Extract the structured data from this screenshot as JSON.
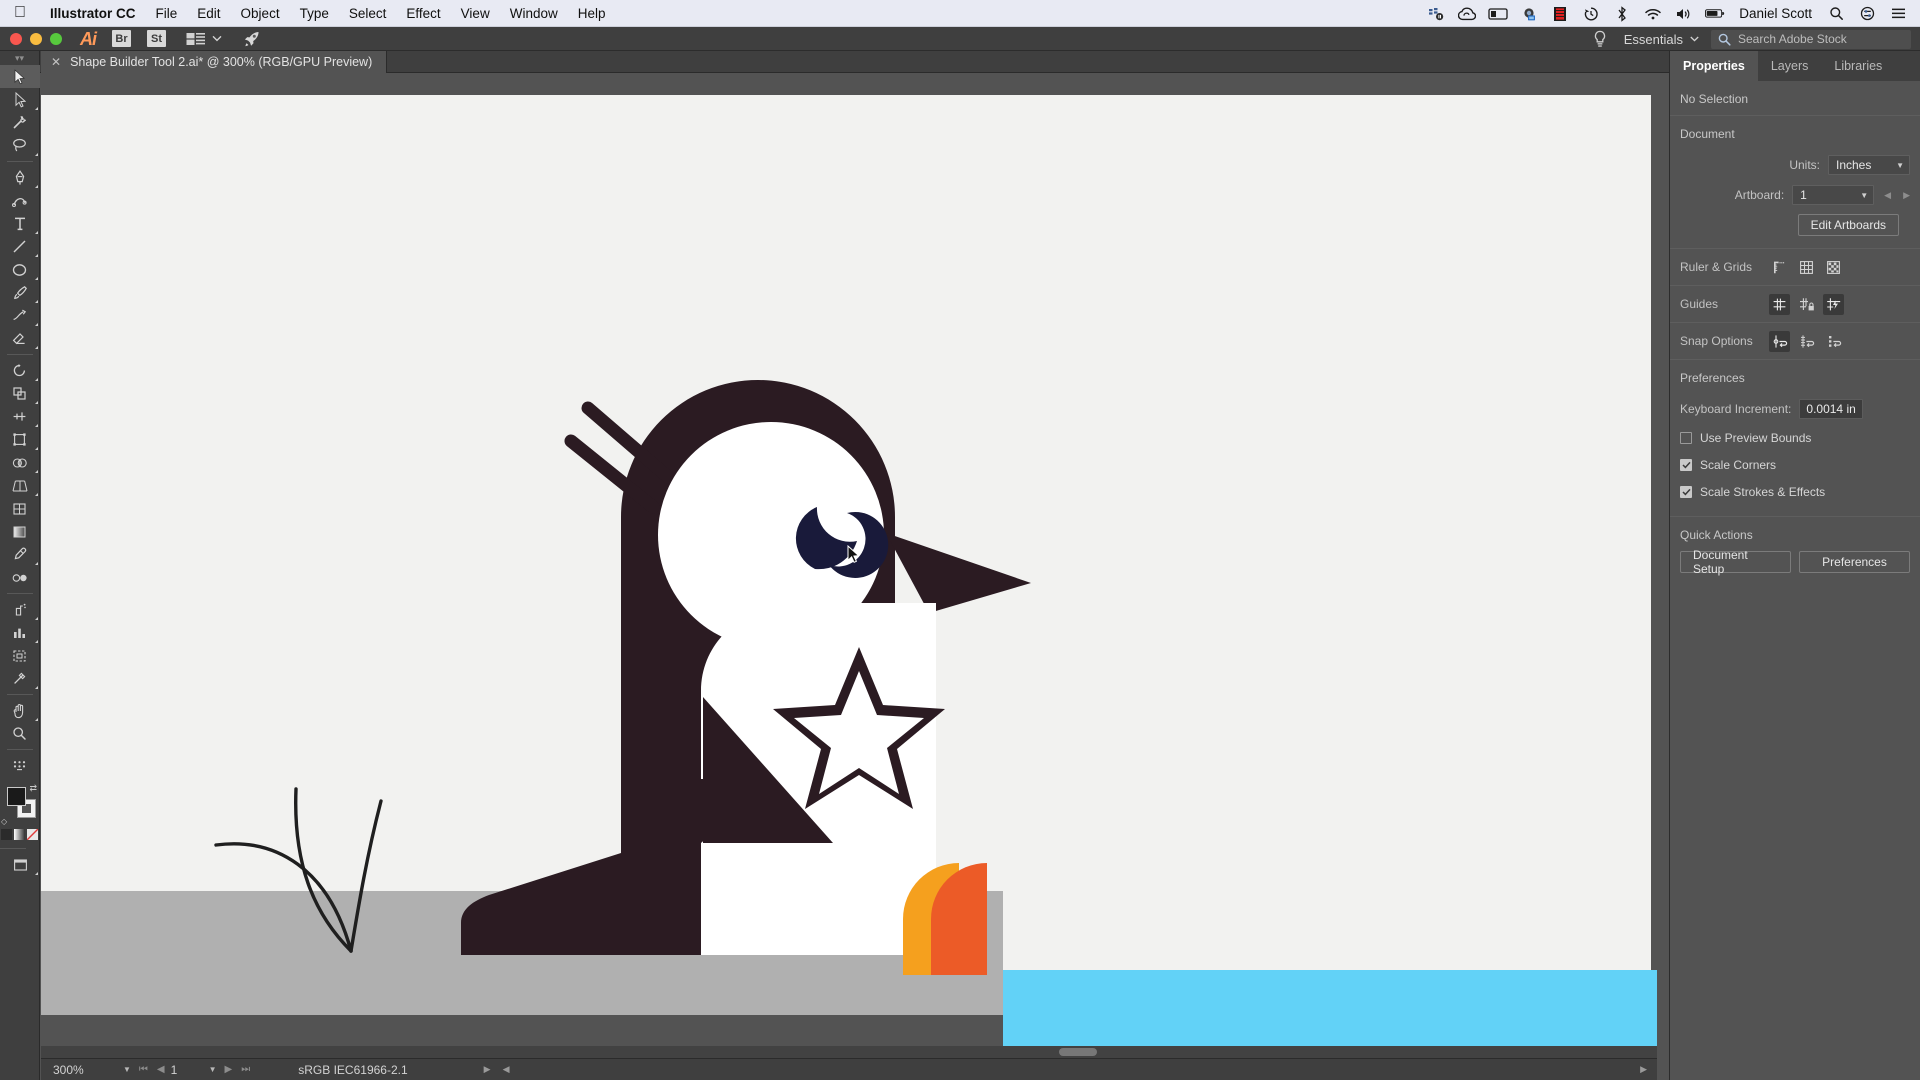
{
  "menubar": {
    "apple_icon": "apple-logo",
    "items": [
      "Illustrator CC",
      "File",
      "Edit",
      "Object",
      "Type",
      "Select",
      "Effect",
      "View",
      "Window",
      "Help"
    ],
    "username": "Daniel Scott",
    "status_icons": [
      "creative-cloud-sync-icon",
      "creative-cloud-icon",
      "display-icon",
      "camera-icon",
      "film-icon",
      "time-machine-icon",
      "bluetooth-icon",
      "wifi-icon",
      "volume-icon",
      "battery-icon",
      "search-icon",
      "control-center-icon",
      "list-icon"
    ]
  },
  "apptoolbar": {
    "app_logo": "Ai",
    "bridge_label": "Br",
    "stock_label": "St",
    "workspace_label": "Essentials",
    "search_placeholder": "Search Adobe Stock",
    "search_icon": "search-icon",
    "bulb_icon": "lightbulb-icon",
    "arrange_icon": "arrange-documents-icon",
    "rocket_icon": "rocket-icon"
  },
  "document_tab": {
    "close_icon": "close-icon",
    "title": "Shape Builder Tool 2.ai* @ 300% (RGB/GPU Preview)"
  },
  "toolbar": {
    "tools": [
      {
        "name": "selection-tool",
        "selected": true
      },
      {
        "name": "direct-selection-tool",
        "selected": false
      },
      {
        "name": "magic-wand-tool",
        "selected": false
      },
      {
        "name": "lasso-tool",
        "selected": false
      },
      {
        "name": "pen-tool",
        "selected": false
      },
      {
        "name": "curvature-tool",
        "selected": false
      },
      {
        "name": "type-tool",
        "selected": false
      },
      {
        "name": "line-segment-tool",
        "selected": false
      },
      {
        "name": "ellipse-tool",
        "selected": false
      },
      {
        "name": "paintbrush-tool",
        "selected": false
      },
      {
        "name": "shaper-tool",
        "selected": false
      },
      {
        "name": "eraser-tool",
        "selected": false
      },
      {
        "name": "rotate-tool",
        "selected": false
      },
      {
        "name": "scale-tool",
        "selected": false
      },
      {
        "name": "width-tool",
        "selected": false
      },
      {
        "name": "free-transform-tool",
        "selected": false
      },
      {
        "name": "shape-builder-tool",
        "selected": false
      },
      {
        "name": "perspective-grid-tool",
        "selected": false
      },
      {
        "name": "mesh-tool",
        "selected": false
      },
      {
        "name": "gradient-tool",
        "selected": false
      },
      {
        "name": "eyedropper-tool",
        "selected": false
      },
      {
        "name": "blend-tool",
        "selected": false
      },
      {
        "name": "symbol-sprayer-tool",
        "selected": false
      },
      {
        "name": "column-graph-tool",
        "selected": false
      },
      {
        "name": "artboard-tool",
        "selected": false
      },
      {
        "name": "slice-tool",
        "selected": false
      },
      {
        "name": "hand-tool",
        "selected": false
      },
      {
        "name": "zoom-tool",
        "selected": false
      }
    ],
    "fill_color": "#1a1a1a",
    "stroke_color": "#f2f2f2"
  },
  "statusbar": {
    "zoom": "300%",
    "page": "1",
    "color_profile": "sRGB IEC61966-2.1",
    "first_icon": "first-artboard-icon",
    "prev_icon": "prev-artboard-icon",
    "next_icon": "next-artboard-icon",
    "last_icon": "last-artboard-icon"
  },
  "panel": {
    "tabs": [
      {
        "label": "Properties",
        "active": true
      },
      {
        "label": "Layers",
        "active": false
      },
      {
        "label": "Libraries",
        "active": false
      }
    ],
    "selection_status": "No Selection",
    "document": {
      "title": "Document",
      "units_label": "Units:",
      "units_value": "Inches",
      "artboard_label": "Artboard:",
      "artboard_value": "1",
      "edit_artboards_label": "Edit Artboards",
      "prev_artboard_icon": "prev-artboard-icon",
      "next_artboard_icon": "next-artboard-icon"
    },
    "ruler_grids": {
      "label": "Ruler & Grids",
      "icons": [
        "show-rulers-icon",
        "show-grid-icon",
        "show-transparency-grid-icon"
      ]
    },
    "guides": {
      "label": "Guides",
      "icons": [
        "show-guides-icon",
        "lock-guides-icon",
        "smart-guides-icon"
      ],
      "active": [
        true,
        false,
        true
      ]
    },
    "snap_options": {
      "label": "Snap Options",
      "icons": [
        "snap-to-point-icon",
        "snap-to-grid-icon",
        "snap-to-pixel-icon"
      ],
      "active": [
        true,
        false,
        false
      ]
    },
    "preferences": {
      "title": "Preferences",
      "keyboard_increment_label": "Keyboard Increment:",
      "keyboard_increment_value": "0.0014 in",
      "checkboxes": [
        {
          "label": "Use Preview Bounds",
          "checked": false
        },
        {
          "label": "Scale Corners",
          "checked": true
        },
        {
          "label": "Scale Strokes & Effects",
          "checked": true
        }
      ]
    },
    "quick_actions": {
      "title": "Quick Actions",
      "buttons": [
        "Document Setup",
        "Preferences"
      ]
    }
  },
  "artwork": {
    "name": "penguin-illustration",
    "colors": {
      "body": "#2b1b22",
      "belly": "#ffffff",
      "eye_white": "#ffffff",
      "pupil": "#191a3a",
      "ground": "#b0b0b0",
      "water": "#62d2f7",
      "fish_left": "#f5a01e",
      "fish_right": "#ec5b27",
      "canvas_bg": "#f2f2f0"
    }
  }
}
